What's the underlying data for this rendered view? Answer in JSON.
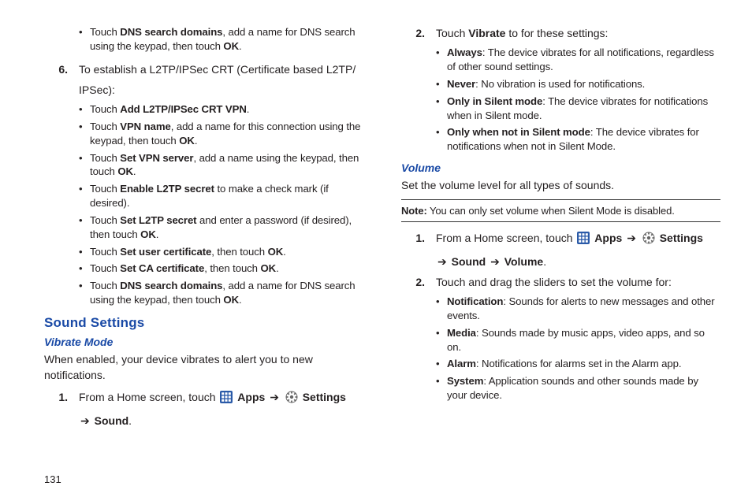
{
  "page_number": "131",
  "left": {
    "bullets_top": [
      {
        "pre": "Touch ",
        "bold": "DNS search domains",
        "post": ", add a name for DNS search using the keypad, then touch ",
        "bold2": "OK",
        "post2": "."
      }
    ],
    "step6": {
      "num": "6.",
      "text": "To establish a L2TP/IPSec CRT (Certificate based L2TP/",
      "text2": "IPSec):"
    },
    "bullets6": [
      {
        "pre": "Touch ",
        "bold": "Add L2TP/IPSec CRT VPN",
        "post": "."
      },
      {
        "pre": "Touch ",
        "bold": "VPN name",
        "post": ", add a name for this connection using the keypad, then touch ",
        "bold2": "OK",
        "post2": "."
      },
      {
        "pre": "Touch ",
        "bold": "Set VPN server",
        "post": ", add a name using the keypad, then touch ",
        "bold2": "OK",
        "post2": "."
      },
      {
        "pre": "Touch ",
        "bold": "Enable L2TP secret",
        "post": " to make a check mark (if desired)."
      },
      {
        "pre": "Touch ",
        "bold": "Set L2TP secret",
        "post": " and enter a password (if desired), then touch ",
        "bold2": "OK",
        "post2": "."
      },
      {
        "pre": "Touch ",
        "bold": "Set user certificate",
        "post": ", then touch ",
        "bold2": "OK",
        "post2": "."
      },
      {
        "pre": "Touch ",
        "bold": "Set CA certificate",
        "post": ", then touch ",
        "bold2": "OK",
        "post2": "."
      },
      {
        "pre": "Touch ",
        "bold": "DNS search domains",
        "post": ", add a name for DNS search using the keypad, then touch ",
        "bold2": "OK",
        "post2": "."
      }
    ],
    "h2": "Sound Settings",
    "h3": "Vibrate Mode",
    "para": "When enabled, your device vibrates to alert you to new notifications.",
    "step1": {
      "num": "1.",
      "pre": "From a Home screen, touch ",
      "apps": "Apps",
      "arrow1": "➔",
      "settings": "Settings",
      "line2_arrow": "➔",
      "sound": "Sound",
      "tail": "."
    }
  },
  "right": {
    "step2": {
      "num": "2.",
      "pre": "Touch ",
      "bold": "Vibrate",
      "post": " to for these settings:"
    },
    "bullets2": [
      {
        "bold": "Always",
        "post": ": The device vibrates for all notifications, regardless of other sound settings."
      },
      {
        "bold": "Never",
        "post": ": No vibration is used for notifications."
      },
      {
        "bold": "Only in Silent mode",
        "post": ": The device vibrates for notifications when in Silent mode."
      },
      {
        "bold": "Only when not in Silent mode",
        "post": ": The device vibrates for notifications when not in Silent Mode."
      }
    ],
    "h3": "Volume",
    "para": "Set the volume level for all types of sounds.",
    "note_label": "Note:",
    "note_text": " You can only set volume when Silent Mode is disabled.",
    "stepV1": {
      "num": "1.",
      "pre": "From a Home screen, touch ",
      "apps": "Apps",
      "arrow1": "➔",
      "settings": "Settings",
      "line2_arrow": "➔",
      "sound": "Sound",
      "arrow2": "➔",
      "volume": "Volume",
      "tail": "."
    },
    "stepV2": {
      "num": "2.",
      "text": "Touch and drag the sliders to set the volume for:"
    },
    "bulletsV": [
      {
        "bold": "Notification",
        "post": ": Sounds for alerts to new messages and other events."
      },
      {
        "bold": "Media",
        "post": ": Sounds made by music apps, video apps, and so on."
      },
      {
        "bold": "Alarm",
        "post": ": Notifications for alarms set in the Alarm app."
      },
      {
        "bold": "System",
        "post": ": Application sounds and other sounds made by your device."
      }
    ]
  }
}
